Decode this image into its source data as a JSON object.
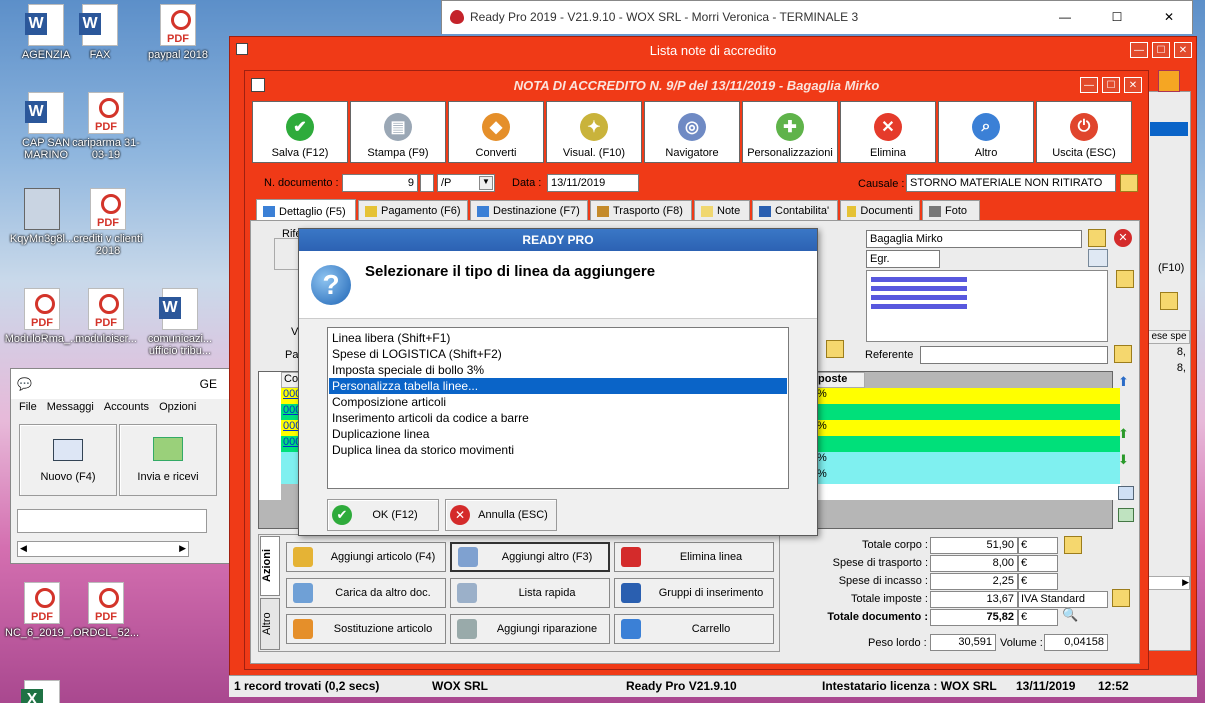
{
  "desktop": {
    "icons": [
      {
        "label": "AGENZIA",
        "type": "word"
      },
      {
        "label": "FAX",
        "type": "word"
      },
      {
        "label": "paypal 2018",
        "type": "pdf"
      },
      {
        "label": "CAP SAN MARINO",
        "type": "word"
      },
      {
        "label": "cariparma 31-03-19",
        "type": "pdf"
      },
      {
        "label": "KqyMn3g8l...",
        "type": "setup"
      },
      {
        "label": "crediti v clienti 2018",
        "type": "pdf"
      },
      {
        "label": "ModuloRma_...",
        "type": "pdf"
      },
      {
        "label": "moduloiscr...",
        "type": "pdf"
      },
      {
        "label": "comunicazi... ufficio tribu...",
        "type": "word"
      },
      {
        "label": "NC_6_2019_...",
        "type": "pdf"
      },
      {
        "label": "ORDCL_52...",
        "type": "pdf"
      }
    ]
  },
  "main_window": {
    "title": "Ready Pro 2019 - V21.9.10 - WOX SRL - Morri Veronica - TERMINALE 3",
    "min": "—",
    "max": "☐",
    "close": "✕"
  },
  "list_window": {
    "title": "Lista note di accredito"
  },
  "mail_window": {
    "title": "GE",
    "menu": [
      "File",
      "Messaggi",
      "Accounts",
      "Opzioni"
    ],
    "buttons": [
      "Nuovo (F4)",
      "Invia e ricevi"
    ]
  },
  "doc": {
    "title": "NOTA DI ACCREDITO N. 9/P del 13/11/2019 - Bagaglia Mirko",
    "toolbar": [
      "Salva (F12)",
      "Stampa (F9)",
      "Converti",
      "Visual. (F10)",
      "Navigatore",
      "Personalizzazioni",
      "Elimina",
      "Altro",
      "Uscita (ESC)"
    ],
    "n_doc_label": "N. documento :",
    "n_doc": "9",
    "sez": "/P",
    "data_label": "Data :",
    "data": "13/11/2019",
    "causale_label": "Causale :",
    "causale": "STORNO MATERIALE NON RITIRATO",
    "tabs": [
      "Dettaglio (F5)",
      "Pagamento (F6)",
      "Destinazione (F7)",
      "Trasporto (F8)",
      "Note",
      "Contabilita'",
      "Documenti",
      "Foto"
    ],
    "rif_label": "Rife",
    "v_label": "V",
    "pa_label": "Pa",
    "cliente": "Bagaglia Mirko",
    "egr": "Egr.",
    "referente_label": "Referente",
    "grid_head_left": "Coo",
    "grid_head_right": "poste",
    "grid_rows_left": [
      "000",
      "000",
      "000",
      "000",
      "",
      ""
    ],
    "grid_rows_right": [
      "%",
      "",
      "%",
      "",
      "%",
      "%"
    ],
    "actions": [
      "Aggiungi articolo (F4)",
      "Aggiungi altro (F3)",
      "Elimina linea",
      "Carica da altro doc.",
      "Lista rapida",
      "Gruppi di inserimento",
      "Sostituzione articolo",
      "Aggiungi riparazione",
      "Carrello"
    ],
    "side_tabs": [
      "Azioni",
      "Altro"
    ],
    "totals": [
      {
        "label": "Totale corpo :",
        "value": "51,90",
        "cur": "€"
      },
      {
        "label": "Spese di trasporto :",
        "value": "8,00",
        "cur": "€"
      },
      {
        "label": "Spese di incasso :",
        "value": "2,25",
        "cur": "€"
      },
      {
        "label": "Totale imposte :",
        "value": "13,67",
        "cur": "IVA Standard"
      },
      {
        "label": "Totale documento :",
        "value": "75,82",
        "cur": "€"
      }
    ],
    "peso_label": "Peso lordo :",
    "peso": "30,591",
    "volume_label": "Volume :",
    "volume": "0,04158",
    "right_panel": {
      "f10": "(F10)",
      "col": "ese spe",
      "v1": "8,",
      "v2": "8,"
    }
  },
  "dialog": {
    "title": "READY PRO",
    "question": "Selezionare il tipo di linea da aggiungere",
    "options": [
      "Linea libera (Shift+F1)",
      "Spese di LOGISTICA (Shift+F2)",
      "Imposta speciale di bollo 3%",
      "Personalizza tabella linee...",
      "Composizione articoli",
      "Inserimento articoli da codice a barre",
      "Duplicazione linea",
      "Duplica linea da storico movimenti"
    ],
    "selected": 3,
    "ok": "OK (F12)",
    "cancel": "Annulla (ESC)"
  },
  "statusbar": [
    "1 record trovati (0,2 secs)",
    "WOX SRL",
    "Ready Pro V21.9.10",
    "Intestatario licenza : WOX SRL",
    "13/11/2019",
    "12:52"
  ]
}
